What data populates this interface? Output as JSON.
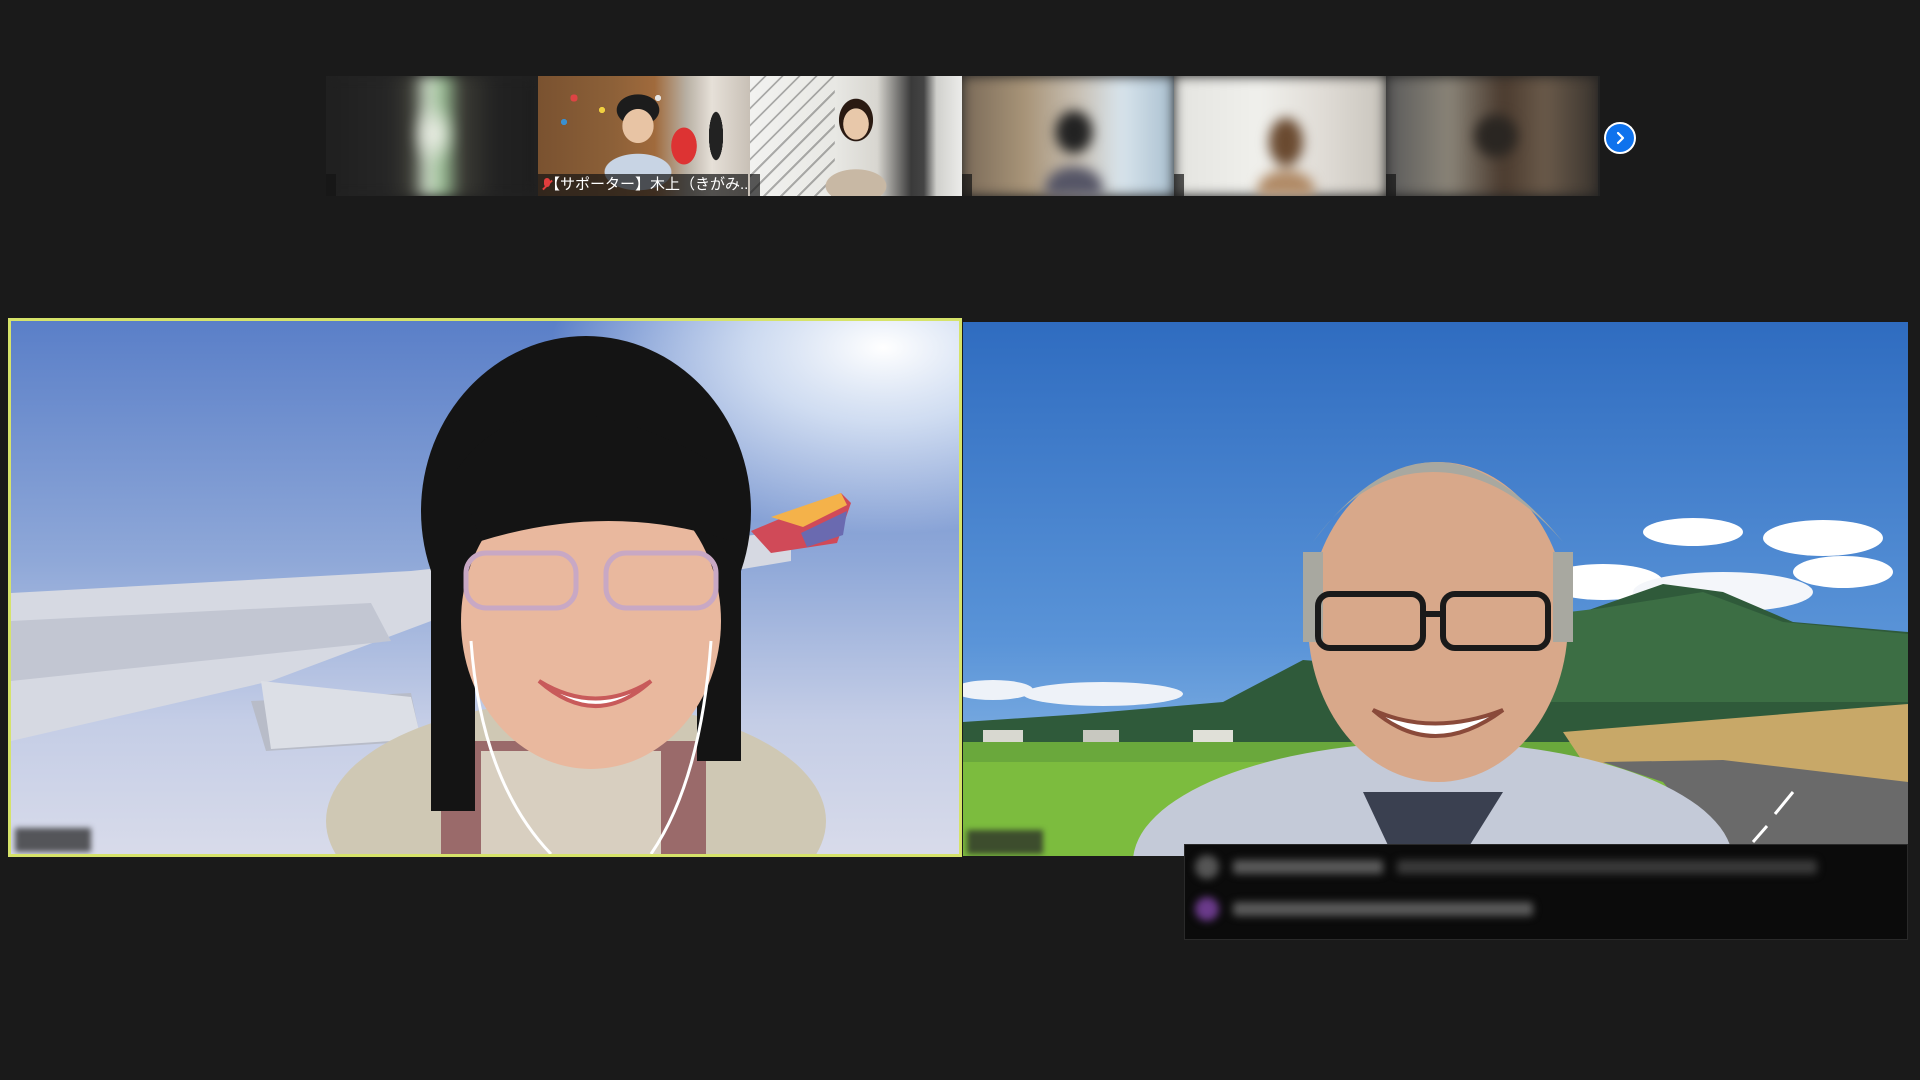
{
  "filmstrip": {
    "tiles": [
      {
        "id": "p1",
        "label": "",
        "muted": false
      },
      {
        "id": "p2",
        "label": "【サポーター】木上（きがみ...",
        "muted": true
      },
      {
        "id": "p3",
        "label": "",
        "muted": false
      },
      {
        "id": "p4",
        "label": "",
        "muted": false
      },
      {
        "id": "p5",
        "label": "",
        "muted": false
      },
      {
        "id": "p6",
        "label": "",
        "muted": false
      }
    ],
    "next_icon": "chevron-right-icon"
  },
  "main": {
    "left_speaker": {
      "name": "",
      "active_speaker": true,
      "background": "airplane-wing-sky"
    },
    "right_speaker": {
      "name": "",
      "active_speaker": false,
      "background": "rice-field-mountains"
    }
  },
  "chat_overlay": {
    "messages": [
      {
        "sender": "",
        "text": ""
      },
      {
        "sender": "",
        "text": ""
      }
    ]
  },
  "colors": {
    "background": "#1a1a1a",
    "active_speaker_border": "#d6e36a",
    "accent": "#0e72ed",
    "mute_red": "#e23d3d"
  }
}
